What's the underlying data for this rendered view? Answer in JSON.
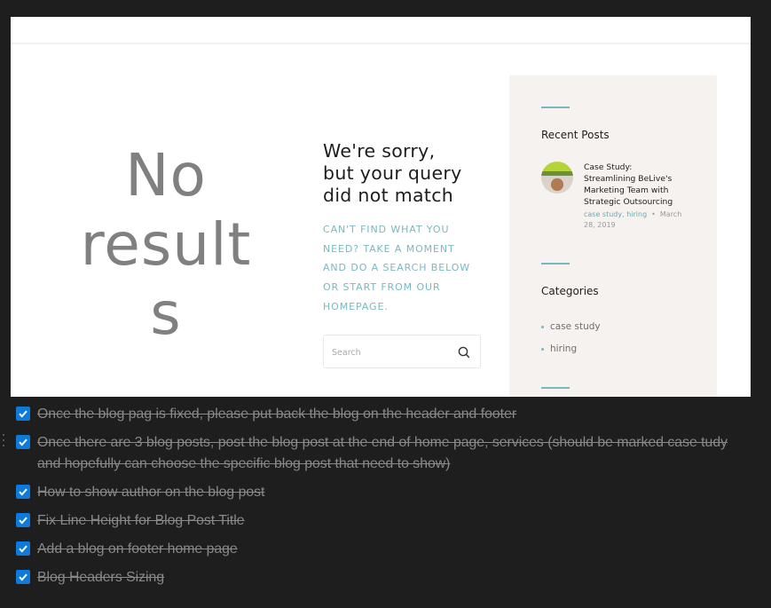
{
  "screenshot": {
    "no_results_lines": [
      "No",
      "result",
      "s"
    ],
    "sorry_lines": [
      "We're sorry,",
      "but your query",
      "did not match"
    ],
    "cant_find_lines": [
      "CAN'T FIND WHAT YOU",
      "NEED? TAKE A MOMENT",
      "AND DO A SEARCH BELOW",
      "OR START FROM OUR",
      "HOMEPAGE."
    ],
    "search": {
      "placeholder": "Search",
      "value": "",
      "icon": "search-icon"
    },
    "sidebar": {
      "recent_posts_title": "Recent Posts",
      "post": {
        "title_lines": [
          "Case Study:",
          "Streamlining BeLive's",
          "Marketing Team with",
          "Strategic Outsourcing"
        ],
        "tags": "case study, hiring",
        "separator": "•",
        "date_line1": "March",
        "date_line2": "28, 2019"
      },
      "categories_title": "Categories",
      "categories": [
        "case study",
        "hiring"
      ]
    },
    "colors": {
      "accent": "#7ab8c0",
      "sidebar_bg": "#f5f2ef",
      "heading": "#1d1d1d",
      "no_results": "#808080"
    }
  },
  "checklist": {
    "items": [
      {
        "checked": true,
        "text": "Once the blog pag is fixed, please put back the blog on the header and footer"
      },
      {
        "checked": true,
        "text": "Once there are 3 blog posts, post the blog post at the end of home page, services (should be marked case tudy and hopefully can choose the specific blog post that need to show)"
      },
      {
        "checked": true,
        "text": "How to show author on the blog post"
      },
      {
        "checked": true,
        "text": "Fix Line Height for Blog Post Title"
      },
      {
        "checked": true,
        "text": "Add a blog on footer home page"
      },
      {
        "checked": true,
        "text": "Blog Headers Sizing"
      }
    ],
    "colors": {
      "checkbox": "#0e7ad9",
      "text": "#888888",
      "background": "#1e1e1e"
    }
  }
}
